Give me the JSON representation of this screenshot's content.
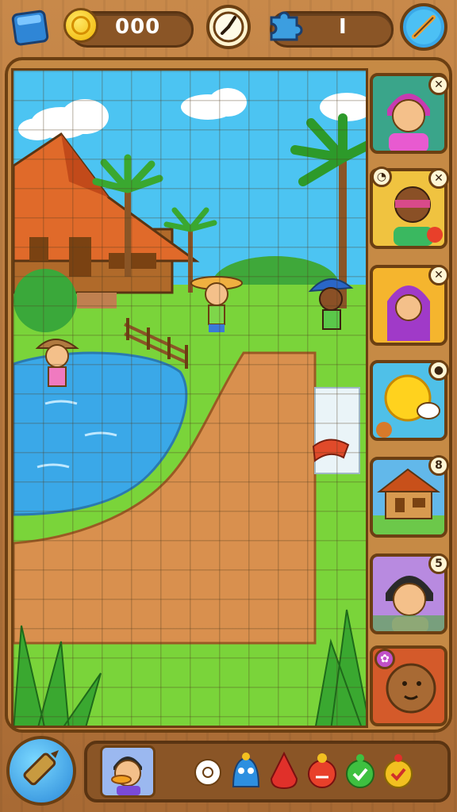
{
  "hud": {
    "coins": "000",
    "pieces": "I",
    "left_button_icon": "blue-card-icon",
    "clock_icon": "clock-icon",
    "puzzle_piece_icon": "puzzle-piece-icon",
    "settings_icon": "wrench-icon"
  },
  "side_cards": [
    {
      "name": "woman-headscarf-card",
      "badge": "",
      "badge_icon": "close-icon",
      "bg": "#3aa58a"
    },
    {
      "name": "blindfold-kid-card",
      "badge": "",
      "badge_icon": "close-icon",
      "bg": "#f0c340"
    },
    {
      "name": "hijab-girl-card",
      "badge": "",
      "badge_icon": "close-icon",
      "bg": "#f5b52e"
    },
    {
      "name": "sun-cloud-card",
      "badge": "",
      "badge_icon": "ladybug-icon",
      "bg": "#4fc0e8"
    },
    {
      "name": "wooden-house-card",
      "badge": "8",
      "badge_icon": "",
      "bg": "#62b8ea"
    },
    {
      "name": "boy-portrait-card",
      "badge": "5",
      "badge_icon": "",
      "bg": "#b88ae0"
    },
    {
      "name": "coconut-face-card",
      "badge": "",
      "badge_icon": "flower-icon",
      "bg": "#d45a2a"
    }
  ],
  "tray": {
    "avatar_icon": "duck-face-boy-icon",
    "items": [
      {
        "name": "white-flower-icon",
        "color": "#ffffff"
      },
      {
        "name": "blue-blob-creature-icon",
        "color": "#2d8fe0"
      },
      {
        "name": "red-drop-icon",
        "color": "#e0302a"
      },
      {
        "name": "red-angry-creature-icon",
        "color": "#e8402a"
      },
      {
        "name": "green-check-creature-icon",
        "color": "#3ec040"
      },
      {
        "name": "yellow-check-creature-icon",
        "color": "#f2c020"
      }
    ]
  },
  "colors": {
    "wood": "#c68a45",
    "frame_border": "#6b3f12",
    "sky": "#4cc4f2",
    "grass": "#7ad43a",
    "water": "#3aa8e8",
    "dirt": "#d9904e"
  }
}
